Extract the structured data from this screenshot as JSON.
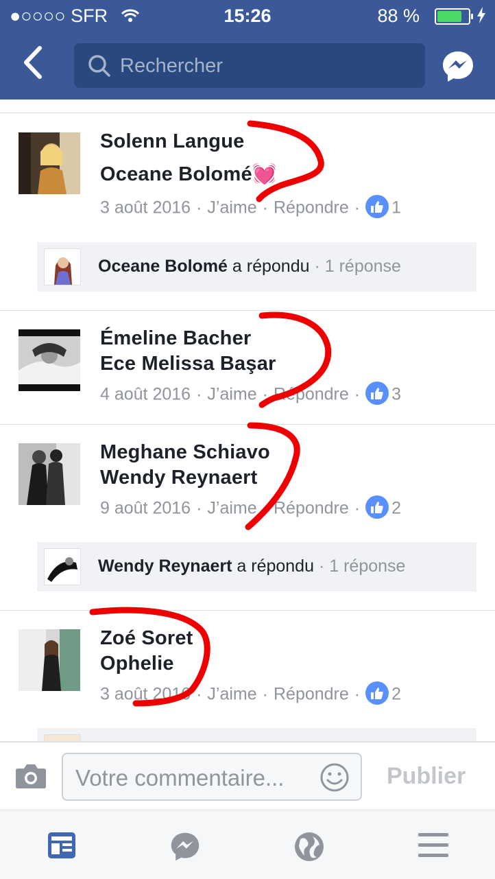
{
  "status": {
    "signal": "●○○○○",
    "carrier": "SFR",
    "time": "15:26",
    "battery_percent": "88 %",
    "battery_level": 0.88
  },
  "header": {
    "search_placeholder": "Rechercher",
    "back_icon": "chevron-left-icon",
    "messenger_icon": "messenger-icon"
  },
  "comments": [
    {
      "author": "Solenn Langue",
      "text": "Oceane Bolomé",
      "emoji": "💓",
      "date": "3 août 2016",
      "like_label": "J’aime",
      "reply_label": "Répondre",
      "likes": "1",
      "reply": {
        "name": "Oceane Bolomé",
        "action": "a répondu",
        "count": "1 réponse"
      }
    },
    {
      "author": "Émeline Bacher",
      "text": "Ece Melissa Başar",
      "emoji": "",
      "date": "4 août 2016",
      "like_label": "J’aime",
      "reply_label": "Répondre",
      "likes": "3"
    },
    {
      "author": "Meghane Schiavo",
      "text": "Wendy Reynaert",
      "emoji": "",
      "date": "9 août 2016",
      "like_label": "J’aime",
      "reply_label": "Répondre",
      "likes": "2",
      "reply": {
        "name": "Wendy Reynaert",
        "action": "a répondu",
        "count": "1 réponse"
      }
    },
    {
      "author": "Zoé Soret",
      "text": "Ophelie",
      "emoji": "",
      "date": "3 août 2016",
      "like_label": "J’aime",
      "reply_label": "Répondre",
      "likes": "2"
    }
  ],
  "composer": {
    "placeholder": "Votre commentaire...",
    "publish_label": "Publier"
  },
  "tabbar": {
    "items": [
      "news-feed-icon",
      "messenger-icon",
      "globe-icon",
      "menu-icon"
    ]
  },
  "colors": {
    "brand": "#3b5998",
    "annotation": "#ee0000",
    "like": "#5890ff"
  }
}
